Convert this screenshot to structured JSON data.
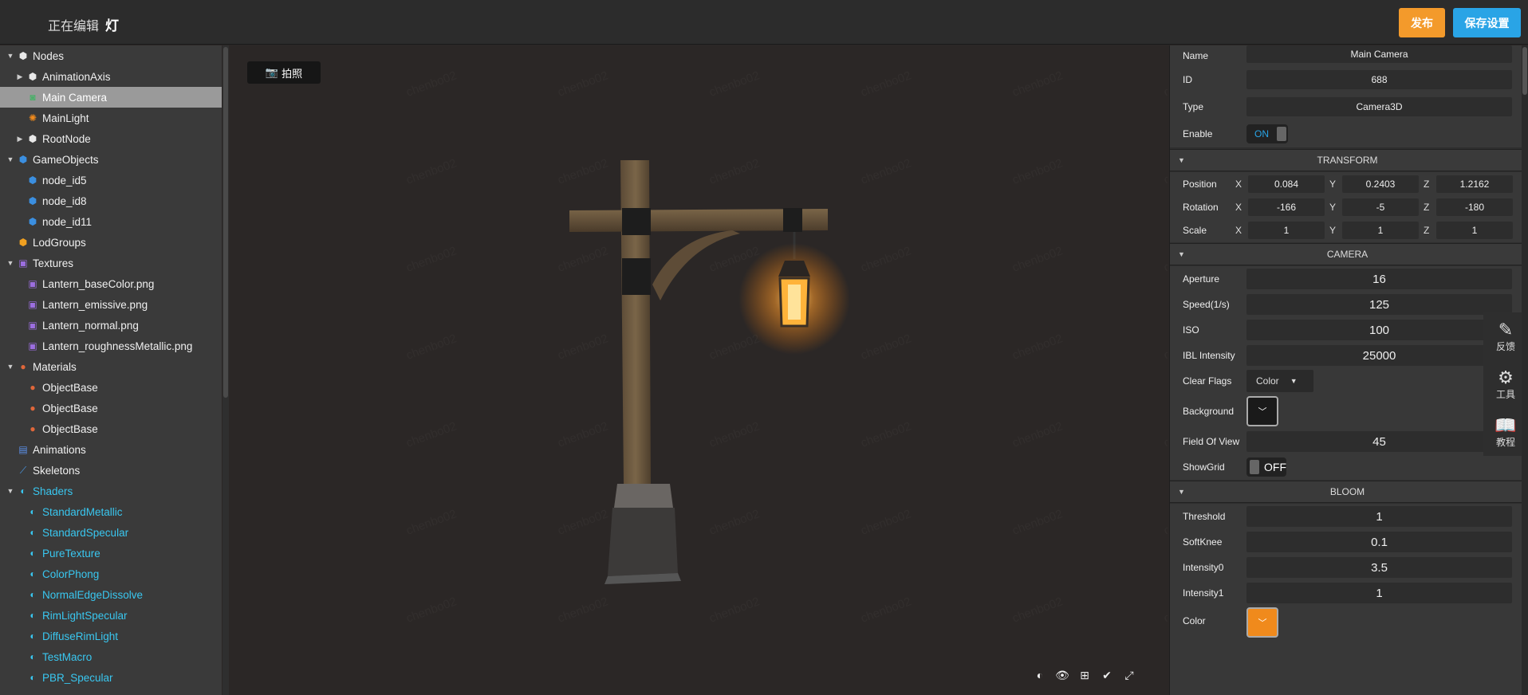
{
  "header": {
    "editing_label": "正在编辑",
    "scene_name": "灯",
    "publish_label": "发布",
    "save_label": "保存设置"
  },
  "tree": {
    "items": [
      {
        "label": "Nodes",
        "icon": "cube-icon",
        "depth": 0,
        "arrow": "down"
      },
      {
        "label": "AnimationAxis",
        "icon": "cube-icon",
        "depth": 1,
        "arrow": "right"
      },
      {
        "label": "Main Camera",
        "icon": "camera-icon",
        "depth": 1,
        "selected": true
      },
      {
        "label": "MainLight",
        "icon": "sun-icon",
        "depth": 1
      },
      {
        "label": "RootNode",
        "icon": "cube-icon",
        "depth": 1,
        "arrow": "right"
      },
      {
        "label": "GameObjects",
        "icon": "cube-blue-icon",
        "depth": 0,
        "arrow": "down"
      },
      {
        "label": "node_id5",
        "icon": "cube-blue-icon",
        "depth": 1
      },
      {
        "label": "node_id8",
        "icon": "cube-blue-icon",
        "depth": 1
      },
      {
        "label": "node_id11",
        "icon": "cube-blue-icon",
        "depth": 1
      },
      {
        "label": "LodGroups",
        "icon": "cube-orange-icon",
        "depth": 0
      },
      {
        "label": "Textures",
        "icon": "image-icon",
        "depth": 0,
        "arrow": "down"
      },
      {
        "label": "Lantern_baseColor.png",
        "icon": "image-icon",
        "depth": 1
      },
      {
        "label": "Lantern_emissive.png",
        "icon": "image-icon",
        "depth": 1
      },
      {
        "label": "Lantern_normal.png",
        "icon": "image-icon",
        "depth": 1
      },
      {
        "label": "Lantern_roughnessMetallic.png",
        "icon": "image-icon",
        "depth": 1
      },
      {
        "label": "Materials",
        "icon": "sphere-icon",
        "depth": 0,
        "arrow": "down"
      },
      {
        "label": "ObjectBase",
        "icon": "sphere-icon",
        "depth": 1
      },
      {
        "label": "ObjectBase",
        "icon": "sphere-icon",
        "depth": 1
      },
      {
        "label": "ObjectBase",
        "icon": "sphere-icon",
        "depth": 1
      },
      {
        "label": "Animations",
        "icon": "film-icon",
        "depth": 0
      },
      {
        "label": "Skeletons",
        "icon": "bone-icon",
        "depth": 0
      },
      {
        "label": "Shaders",
        "icon": "shader-icon",
        "depth": 0,
        "arrow": "down",
        "cyan": true
      },
      {
        "label": "StandardMetallic",
        "icon": "shader-icon",
        "depth": 1,
        "cyan": true
      },
      {
        "label": "StandardSpecular",
        "icon": "shader-icon",
        "depth": 1,
        "cyan": true
      },
      {
        "label": "PureTexture",
        "icon": "shader-icon",
        "depth": 1,
        "cyan": true
      },
      {
        "label": "ColorPhong",
        "icon": "shader-icon",
        "depth": 1,
        "cyan": true
      },
      {
        "label": "NormalEdgeDissolve",
        "icon": "shader-icon",
        "depth": 1,
        "cyan": true
      },
      {
        "label": "RimLightSpecular",
        "icon": "shader-icon",
        "depth": 1,
        "cyan": true
      },
      {
        "label": "DiffuseRimLight",
        "icon": "shader-icon",
        "depth": 1,
        "cyan": true
      },
      {
        "label": "TestMacro",
        "icon": "shader-icon",
        "depth": 1,
        "cyan": true
      },
      {
        "label": "PBR_Specular",
        "icon": "shader-icon",
        "depth": 1,
        "cyan": true
      }
    ]
  },
  "viewport": {
    "photo_label": "拍照",
    "watermark": "chenbo02"
  },
  "props": {
    "name_label": "Name",
    "name_value": "Main Camera",
    "id_label": "ID",
    "id_value": "688",
    "type_label": "Type",
    "type_value": "Camera3D",
    "enable_label": "Enable",
    "enable_value": "ON",
    "transform_title": "TRANSFORM",
    "position_label": "Position",
    "position": {
      "x": "0.084",
      "y": "0.2403",
      "z": "1.2162"
    },
    "rotation_label": "Rotation",
    "rotation": {
      "x": "-166",
      "y": "-5",
      "z": "-180"
    },
    "scale_label": "Scale",
    "scale": {
      "x": "1",
      "y": "1",
      "z": "1"
    },
    "axis_x": "X",
    "axis_y": "Y",
    "axis_z": "Z",
    "camera_title": "CAMERA",
    "aperture_label": "Aperture",
    "aperture_value": "16",
    "speed_label": "Speed(1/s)",
    "speed_value": "125",
    "iso_label": "ISO",
    "iso_value": "100",
    "ibl_label": "IBL Intensity",
    "ibl_value": "25000",
    "clearflags_label": "Clear Flags",
    "clearflags_value": "Color",
    "background_label": "Background",
    "fov_label": "Field Of View",
    "fov_value": "45",
    "showgrid_label": "ShowGrid",
    "showgrid_value": "OFF",
    "bloom_title": "BLOOM",
    "threshold_label": "Threshold",
    "threshold_value": "1",
    "softknee_label": "SoftKnee",
    "softknee_value": "0.1",
    "intensity0_label": "Intensity0",
    "intensity0_value": "3.5",
    "intensity1_label": "Intensity1",
    "intensity1_value": "1",
    "color_label": "Color"
  },
  "side_tools": {
    "feedback": "反馈",
    "tools": "工具",
    "tutorial": "教程"
  },
  "colors": {
    "publish": "#f39a2b",
    "save": "#29a4e6",
    "shader_text": "#39c7f0",
    "bloom_color": "#f08a1c",
    "background_color": "#1a1a1a"
  }
}
